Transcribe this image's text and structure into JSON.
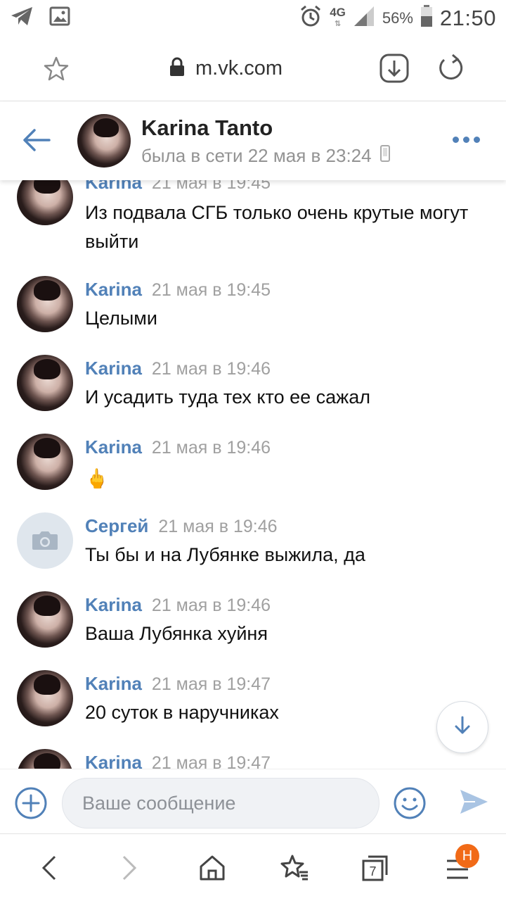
{
  "status_bar": {
    "network": "4G",
    "battery": "56%",
    "time": "21:50"
  },
  "browser": {
    "url": "m.vk.com"
  },
  "chat": {
    "name": "Karina Tanto",
    "status": "была в сети 22 мая в 23:24"
  },
  "messages": [
    {
      "author": "Karina",
      "time": "21 мая в 19:45",
      "text": "Из подвала СГБ только очень крутые могут выйти",
      "avatar": "photo"
    },
    {
      "author": "Karina",
      "time": "21 мая в 19:45",
      "text": "Целыми",
      "avatar": "photo"
    },
    {
      "author": "Karina",
      "time": "21 мая в 19:46",
      "text": "И усадить туда тех кто ее сажал",
      "avatar": "photo"
    },
    {
      "author": "Karina",
      "time": "21 мая в 19:46",
      "text": "🖕",
      "avatar": "photo"
    },
    {
      "author": "Сергей",
      "time": "21 мая в 19:46",
      "text": "Ты бы и на Лубянке выжила, да",
      "avatar": "camera"
    },
    {
      "author": "Karina",
      "time": "21 мая в 19:46",
      "text": "Ваша Лубянка хуйня",
      "avatar": "photo"
    },
    {
      "author": "Karina",
      "time": "21 мая в 19:47",
      "text": "20 суток в наручниках",
      "avatar": "photo"
    },
    {
      "author": "Karina",
      "time": "21 мая в 19:47",
      "text": "",
      "avatar": "photo"
    }
  ],
  "composer": {
    "placeholder": "Ваше сообщение"
  },
  "bottom_nav": {
    "tabs_count": "7",
    "notification_badge": "H"
  },
  "colors": {
    "accent": "#5181b8",
    "badge": "#f16a17"
  }
}
